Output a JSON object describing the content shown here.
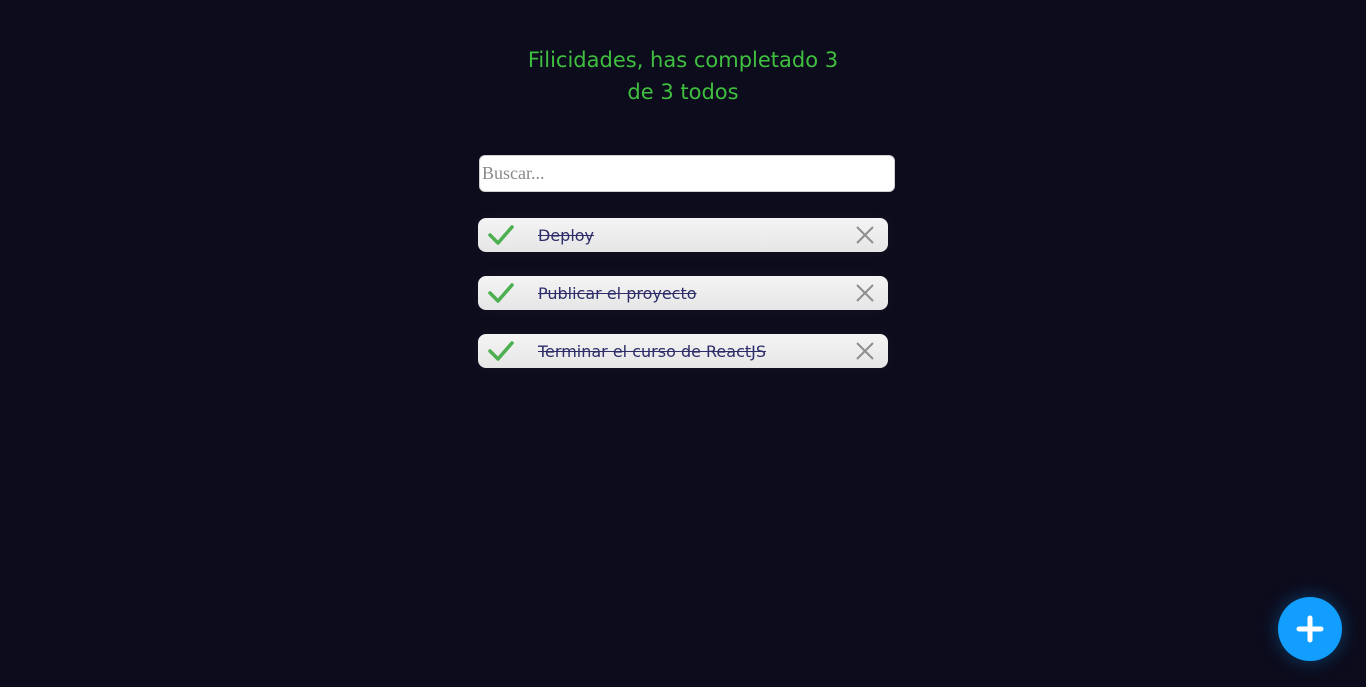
{
  "header": {
    "counter_title": "Filicidades, has completado 3 de 3 todos"
  },
  "search": {
    "placeholder": "Buscar...",
    "value": ""
  },
  "todos": [
    {
      "text": "Deploy",
      "completed": true,
      "check_icon": "check-icon",
      "delete_icon": "close-icon"
    },
    {
      "text": "Publicar el proyecto",
      "completed": true,
      "check_icon": "check-icon",
      "delete_icon": "close-icon"
    },
    {
      "text": "Terminar el curso de ReactJS",
      "completed": true,
      "check_icon": "check-icon",
      "delete_icon": "close-icon"
    }
  ],
  "fab": {
    "icon": "plus-icon"
  },
  "colors": {
    "background": "#0c0c1c",
    "title": "#3fbf3f",
    "check": "#4caf50",
    "delete": "#8e8e8e",
    "fab": "#119eff",
    "todo_text": "#2d2d6a"
  }
}
